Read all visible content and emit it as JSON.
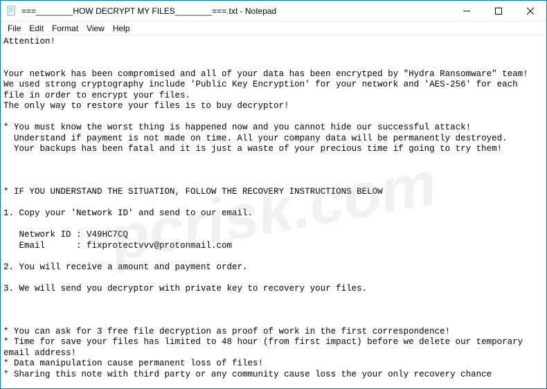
{
  "window": {
    "title": "===________HOW DECRYPT MY FILES________===.txt - Notepad"
  },
  "menu": {
    "file": "File",
    "edit": "Edit",
    "format": "Format",
    "view": "View",
    "help": "Help"
  },
  "content": {
    "text": "Attention!\n\n\nYour network has been compromised and all of your data has been encrytped by \"Hydra Ransomware\" team!\nWe used strong cryptography include 'Public Key Encryption' for your network and 'AES-256' for each\nfile in order to encrypt your files.\nThe only way to restore your files is to buy decryptor!\n\n* You must know the worst thing is happened now and you cannot hide our successful attack!\n  Understand if payment is not made on time. All your company data will be permanently destroyed.\n  Your backups has been fatal and it is just a waste of your precious time if going to try them!\n\n\n\n* IF YOU UNDERSTAND THE SITUATION, FOLLOW THE RECOVERY INSTRUCTIONS BELOW\n\n1. Copy your 'Network ID' and send to our email.\n\n   Network ID : V49HC7CQ\n   Email      : fixprotectvvv@protonmail.com\n\n2. You will receive a amount and payment order.\n\n3. We will send you decryptor with private key to recovery your files.\n\n\n\n* You can ask for 3 free file decryption as proof of work in the first correspondence!\n* Time for save your files has limited to 48 hour (from first impact) before we delete our temporary\nemail address!\n* Data manipulation cause permanent loss of files!\n* Sharing this note with third party or any community cause loss the your only recovery chance"
  },
  "watermark": {
    "text": "pcrisk.com"
  }
}
